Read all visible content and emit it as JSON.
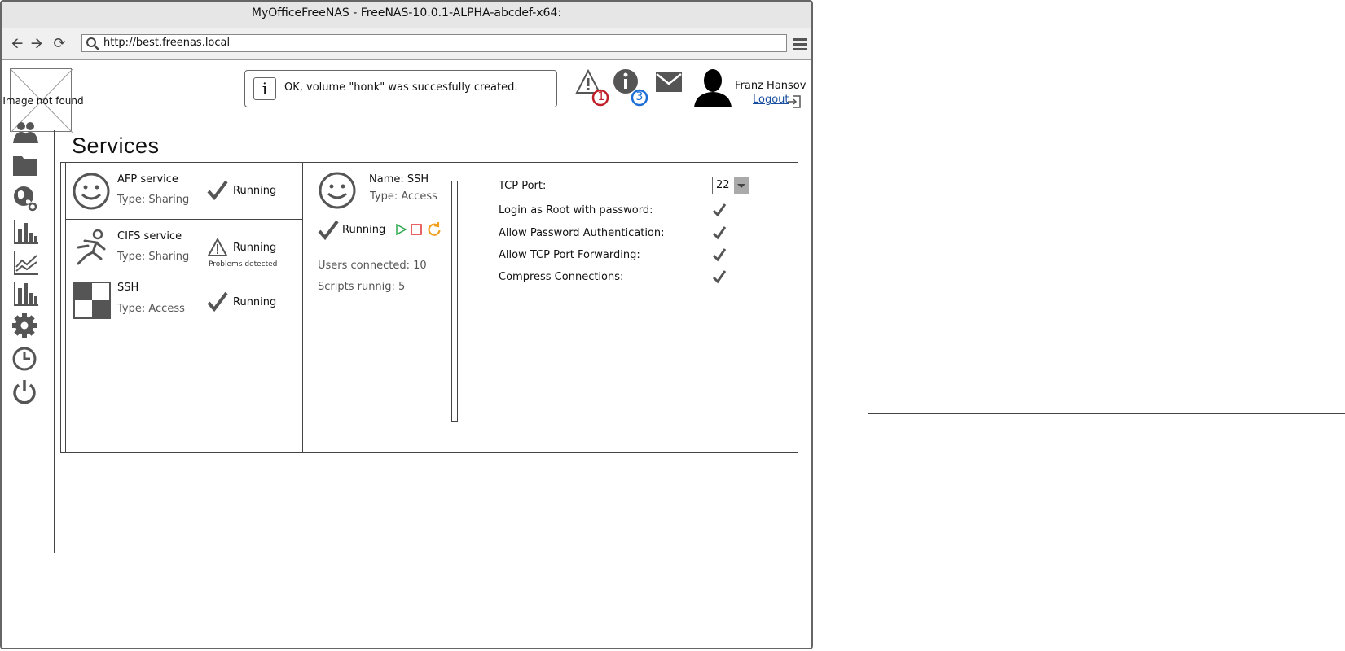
{
  "window": {
    "title": "MyOfficeFreeNAS - FreeNAS-10.0.1-ALPHA-abcdef-x64:",
    "url": "http://best.freenas.local"
  },
  "logo": {
    "alt_text": "Image not found"
  },
  "notification": {
    "text": "OK, volume \"honk\" was succesfully created."
  },
  "header": {
    "alerts_count": "1",
    "info_count": "3",
    "user_name": "Franz Hansov",
    "logout_label": "Logout",
    "colors": {
      "alert_badge": "#c0202a",
      "info_badge": "#1d6fd6"
    }
  },
  "sidebar": {
    "icons": [
      "users-icon",
      "folder-icon",
      "network-globe-icon",
      "bar-chart-icon",
      "line-chart-icon",
      "reports-chart-icon",
      "gear-icon",
      "clock-icon",
      "power-icon"
    ]
  },
  "page": {
    "title": "Services"
  },
  "services": [
    {
      "name": "AFP service",
      "type": "Type: Sharing",
      "status": "Running",
      "status_icon": "check-icon",
      "note": ""
    },
    {
      "name": "CIFS service",
      "type": "Type: Sharing",
      "status": "Running",
      "status_icon": "warning-icon",
      "note": "Problems detected"
    },
    {
      "name": "SSH",
      "type": "Type: Access",
      "status": "Running",
      "status_icon": "check-icon",
      "note": ""
    }
  ],
  "detail": {
    "name": "Name: SSH",
    "type": "Type: Access",
    "status": "Running",
    "users_connected": "Users connected: 10",
    "scripts_running": "Scripts runnig: 5",
    "controls": {
      "play_color": "#2aa84a",
      "stop_color": "#e03030",
      "restart_color": "#f0a020"
    }
  },
  "settings": {
    "tcp_port_label": "TCP Port:",
    "tcp_port_value": "22",
    "login_root_label": "Login as Root with password:",
    "password_auth_label": "Allow Password Authentication:",
    "tcp_forwarding_label": "Allow TCP Port Forwarding:",
    "compress_label": "Compress Connections:"
  }
}
